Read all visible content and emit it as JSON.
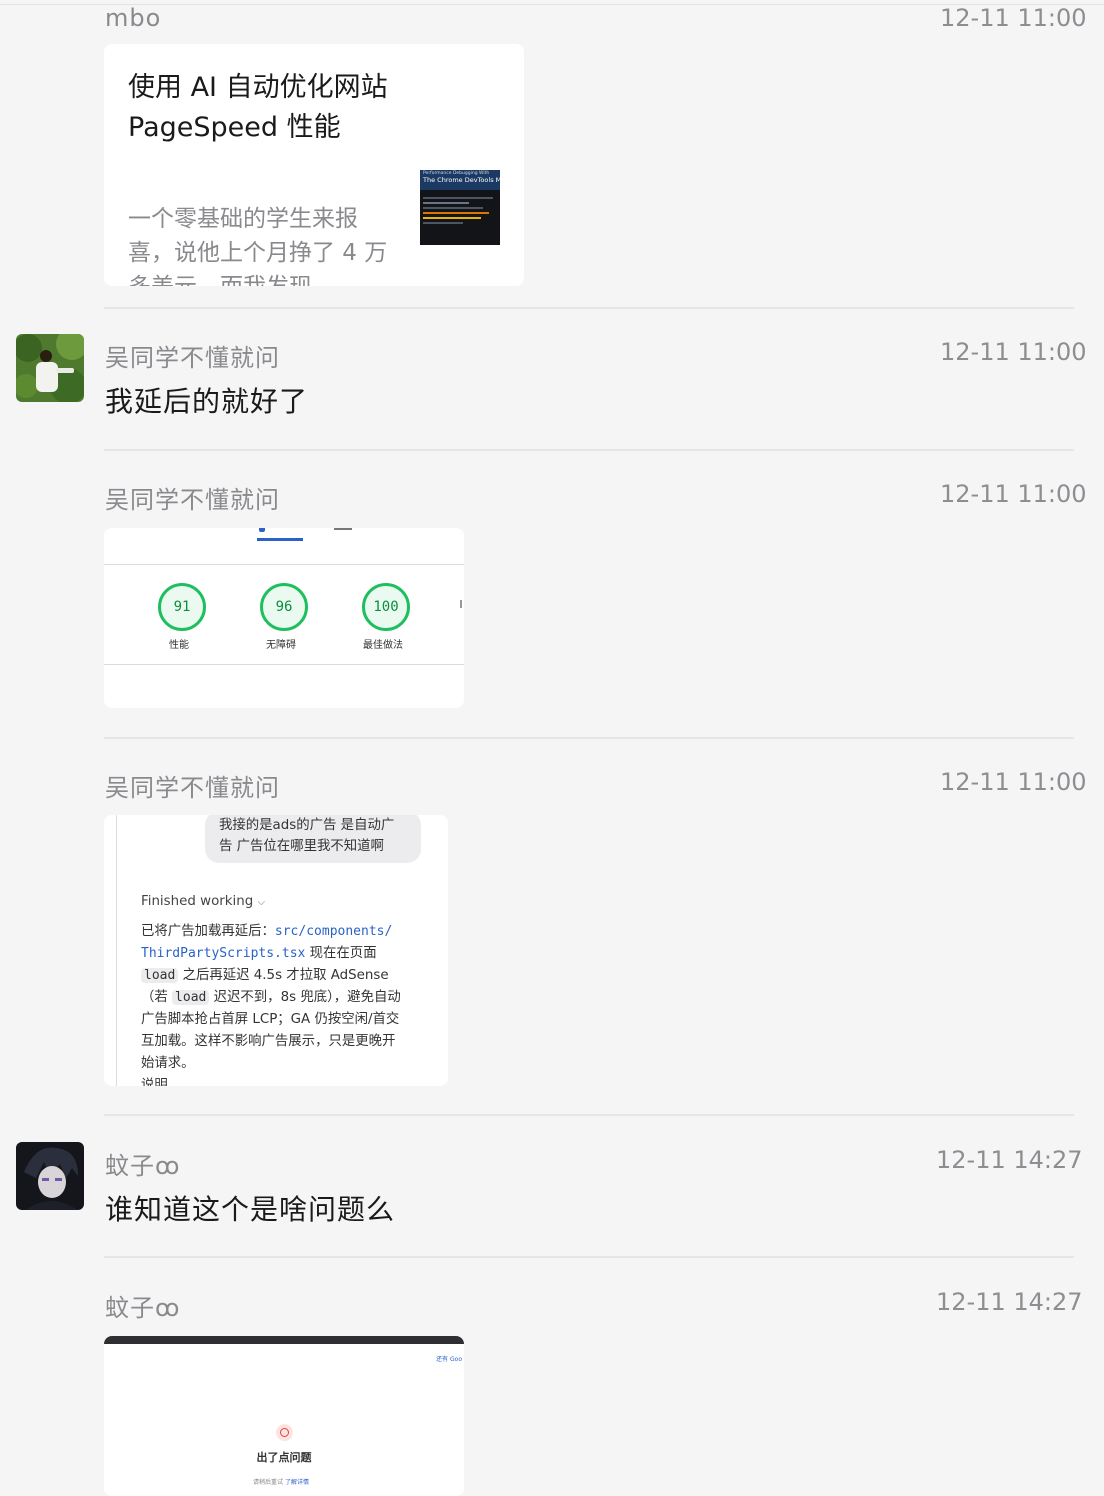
{
  "messages": [
    {
      "sender": "mbo",
      "time": "12-11 11:00",
      "link": {
        "title": "使用 AI 自动优化网站 PageSpeed 性能",
        "description": "一个零基础的学生来报喜，说他上个月挣了 4 万多美元。而我发现...",
        "thumb_caption": "Performance Debugging With",
        "thumb_title": "The Chrome DevTools M"
      }
    },
    {
      "sender": "吴同学不懂就问",
      "time": "12-11 11:00",
      "text": "我延后的就好了"
    },
    {
      "sender": "吴同学不懂就问",
      "time": "12-11 11:00",
      "scores": [
        {
          "value": "91",
          "label": "性能"
        },
        {
          "value": "96",
          "label": "无障碍"
        },
        {
          "value": "100",
          "label": "最佳做法"
        }
      ]
    },
    {
      "sender": "吴同学不懂就问",
      "time": "12-11 11:00",
      "codex": {
        "bubble_line1": "我接的是ads的广告 是自动广",
        "bubble_line2": "告 广告位在哪里我不知道啊",
        "status": "Finished working",
        "l1_a": "已将广告加载再延后：",
        "l1_code": "src/components/",
        "l2_code": "ThirdPartyScripts.tsx",
        "l2_b": " 现在在页面",
        "l3_code": "load",
        "l3_b": " 之后再延迟 4.5s 才拉取 AdSense",
        "l4_a": "（若 ",
        "l4_code": "load",
        "l4_b": " 迟迟不到，8s 兜底），避免自动",
        "l5": "广告脚本抢占首屏 LCP；GA 仍按空闲/首交",
        "l6": "互加载。这样不影响广告展示，只是更晚开",
        "l7": "始请求。",
        "l8": "说明"
      }
    },
    {
      "sender": "蚊子ꝏ",
      "time": "12-11 14:27",
      "text": "谁知道这个是啥问题么"
    },
    {
      "sender": "蚊子ꝏ",
      "time": "12-11 14:27",
      "error": {
        "title": "出了点问题",
        "corner": "还有 Goo",
        "hint": "请稍后重试",
        "link": "了解详情"
      }
    }
  ],
  "colors": {
    "score_green": "#1fbf5f",
    "error_red": "#e0453a",
    "link_blue": "#2a62c9"
  }
}
